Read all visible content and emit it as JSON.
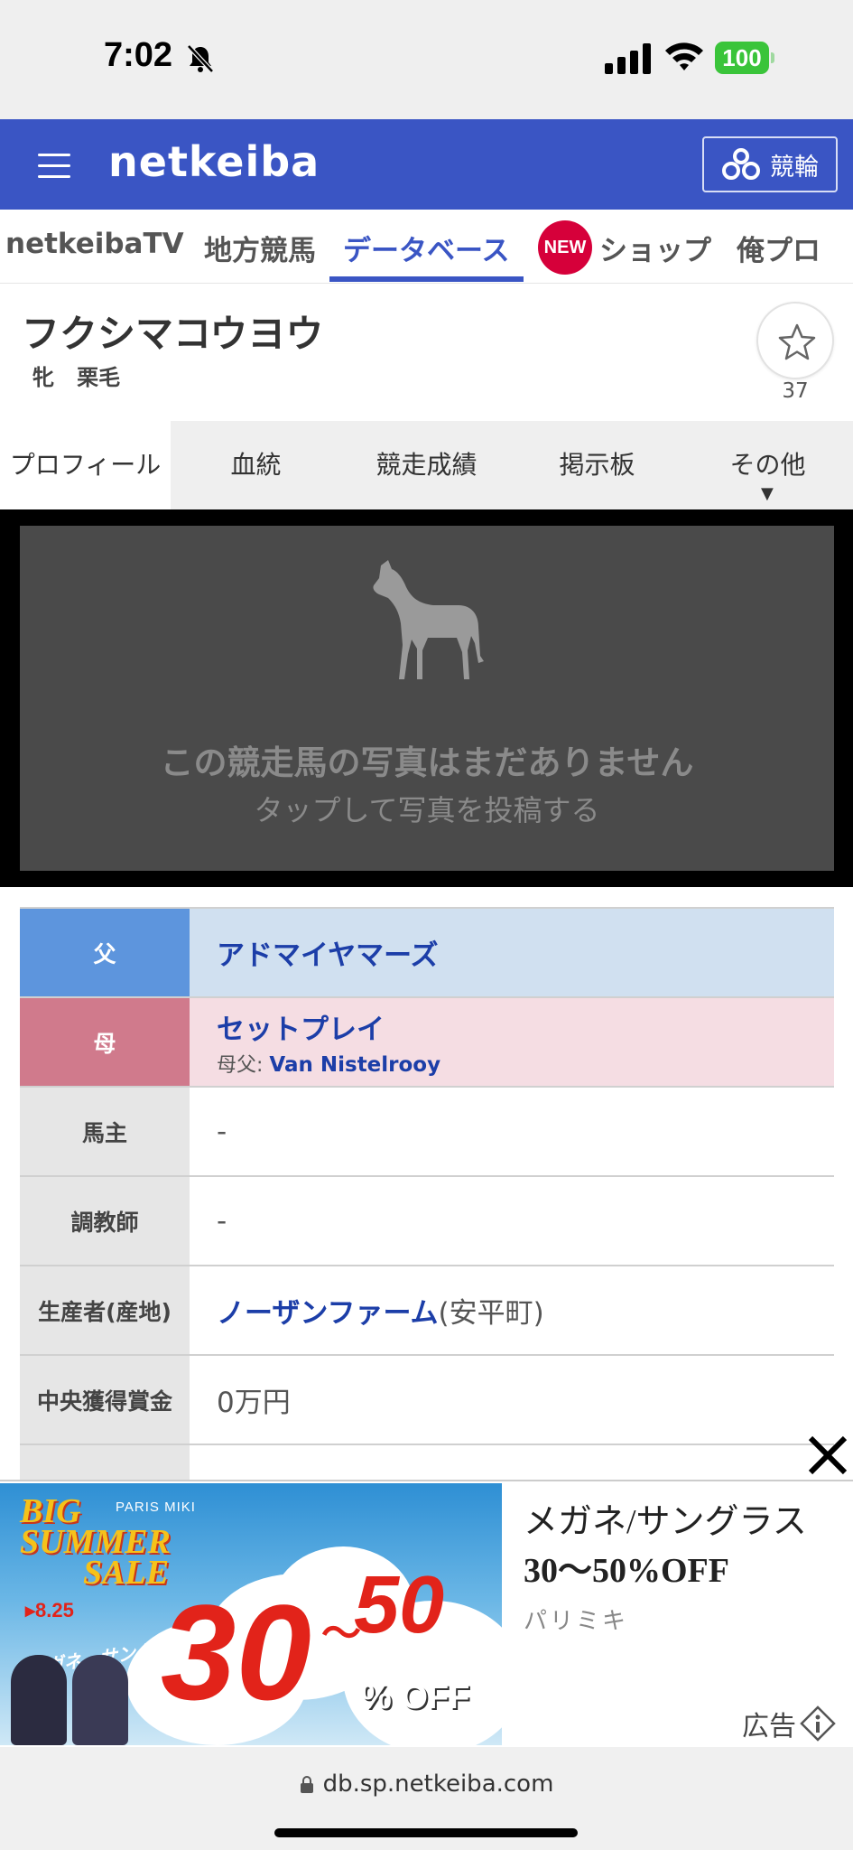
{
  "status_bar": {
    "time": "7:02",
    "battery": "100"
  },
  "header": {
    "logo": "netkeiba",
    "keirin_label": "競輪"
  },
  "nav": {
    "items": [
      "netkeibaTV",
      "地方競馬",
      "データベース",
      "ショップ",
      "俺プロ"
    ],
    "new_badge": "NEW",
    "active": "データベース"
  },
  "horse": {
    "name": "フクシマコウヨウ",
    "sex": "牝",
    "color": "栗毛",
    "favorite_count": "37"
  },
  "subtabs": {
    "items": [
      "プロフィール",
      "血統",
      "競走成績",
      "掲示板",
      "その他"
    ],
    "more_arrow": "▼"
  },
  "photo": {
    "message": "この競走馬の写真はまだありません",
    "link": "タップして写真を投稿する"
  },
  "profile": {
    "sire": {
      "label": "父",
      "value": "アドマイヤマーズ"
    },
    "dam": {
      "label": "母",
      "value": "セットプレイ",
      "bms_label": "母父:",
      "bms_value": "Van Nistelrooy"
    },
    "owner": {
      "label": "馬主",
      "value": "-"
    },
    "trainer": {
      "label": "調教師",
      "value": "-"
    },
    "breeder": {
      "label": "生産者(産地)",
      "value": "ノーザンファーム",
      "region": "(安平町)"
    },
    "central_prize": {
      "label": "中央獲得賞金",
      "value": "0万円"
    }
  },
  "ad": {
    "title_line1": "メガネ/サングラス",
    "title_line2": "30〜50%OFF",
    "brand": "パリミキ",
    "label": "広告",
    "img_big": "BIG",
    "img_summer": "SUMMER",
    "img_sale": "SALE",
    "img_parismiki": "PARIS MIKI",
    "img_date": "▸8.25",
    "img_mega": "メガネ・サングラス",
    "img_30": "30",
    "img_50": "50",
    "img_tilde": "〜",
    "img_off": "% OFF"
  },
  "url_bar": {
    "url": "db.sp.netkeiba.com"
  },
  "colors": {
    "brand_blue": "#3a55c4",
    "sire_header": "#5d95dd",
    "dam_header": "#d07a8c",
    "link": "#1c3ea8",
    "new_badge": "#d6003a"
  }
}
